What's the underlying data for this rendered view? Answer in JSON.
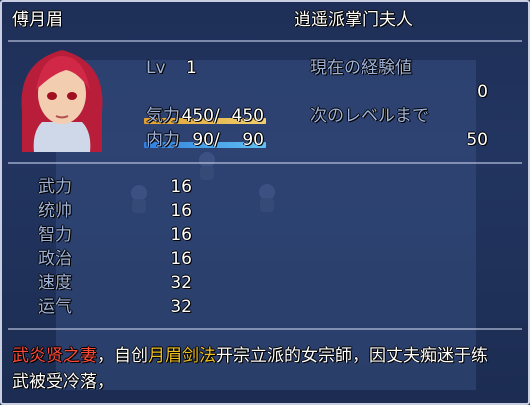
{
  "header": {
    "name": "傅月眉",
    "title": "逍遥派掌门夫人"
  },
  "level": {
    "label": "Lv",
    "value": "1"
  },
  "hp": {
    "label": "気力",
    "current": "450",
    "max": "450",
    "fill": 1.0
  },
  "mp": {
    "label": "内力",
    "current": "90",
    "max": "90",
    "fill": 1.0
  },
  "exp": {
    "current_label": "現在の経験値",
    "current_value": "0",
    "next_label": "次のレベルまで",
    "next_value": "50"
  },
  "stats": [
    {
      "label": "武力",
      "value": "16"
    },
    {
      "label": "统帅",
      "value": "16"
    },
    {
      "label": "智力",
      "value": "16"
    },
    {
      "label": "政治",
      "value": "16"
    },
    {
      "label": "速度",
      "value": "32"
    },
    {
      "label": "运气",
      "value": "32"
    }
  ],
  "description": {
    "title_red": "武炎贤之妻",
    "p1": "，自创",
    "gold1": "月眉",
    "gold2": "剑法",
    "p2": "开宗立派的女宗師，因丈夫痴迷于练",
    "line2": "武被受冷落，"
  },
  "colors": {
    "hp_gauge_start": "#e0a030",
    "hp_gauge_end": "#f0d070",
    "mp_gauge_start": "#3080e0",
    "mp_gauge_end": "#60c0f0",
    "system_text": "#9fb3d9",
    "highlight_red": "#ff4a3a",
    "highlight_gold": "#f0c020"
  },
  "icons": [
    "portrait",
    "ghost-sprite-icon"
  ]
}
